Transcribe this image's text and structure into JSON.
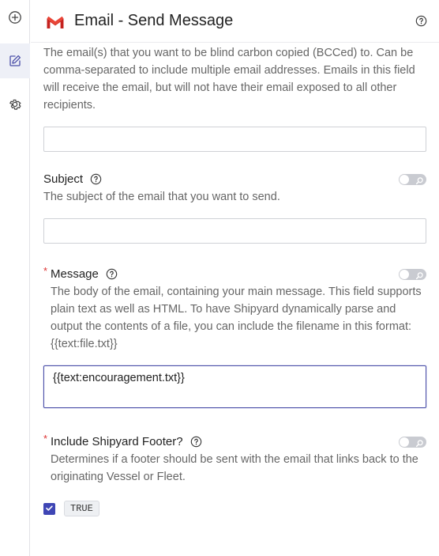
{
  "header": {
    "title": "Email - Send Message",
    "logo_icon": "gmail-logo-icon",
    "help_icon": "help-circle-icon"
  },
  "rail": {
    "items": [
      {
        "name": "add",
        "icon": "plus-circle-icon",
        "active": false
      },
      {
        "name": "edit",
        "icon": "edit-icon",
        "active": true
      },
      {
        "name": "settings",
        "icon": "gear-icon",
        "active": false
      }
    ]
  },
  "bcc": {
    "description": "The email(s) that you want to be blind carbon copied (BCCed) to. Can be comma-separated to include multiple email addresses. Emails in this field will receive the email, but will not have their email exposed to all other recipients.",
    "value": ""
  },
  "subject": {
    "label": "Subject",
    "description": "The subject of the email that you want to send.",
    "value": ""
  },
  "message": {
    "required_mark": "*",
    "label": "Message",
    "description": "The body of the email, containing your main message. This field supports plain text as well as HTML. To have Shipyard dynamically parse and output the contents of a file, you can include the filename in this format: {{text:file.txt}}",
    "value": "{{text:encouragement.txt}}"
  },
  "footer_option": {
    "required_mark": "*",
    "label": "Include Shipyard Footer?",
    "description": "Determines if a footer should be sent with the email that links back to the originating Vessel or Fleet.",
    "checked": true,
    "value_chip": "TRUE"
  },
  "colors": {
    "accent": "#3f46b5",
    "required": "#dd3333",
    "toggle_off": "#c9cbd1",
    "gmail_red": "#d93025"
  }
}
